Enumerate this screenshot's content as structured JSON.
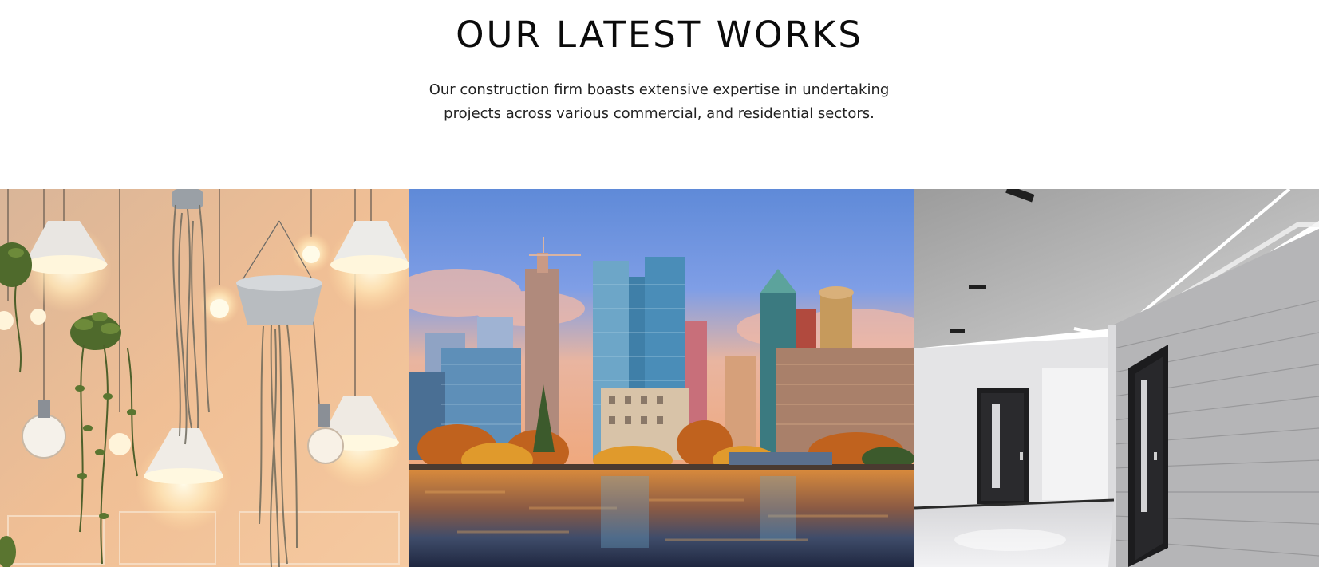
{
  "section": {
    "title": "OUR LATEST WORKS",
    "description": "Our construction firm boasts extensive expertise in undertaking projects across various commercial, and residential sectors."
  },
  "works": [
    {
      "image": "pendant-lamps-hanging-plants-photo"
    },
    {
      "image": "city-skyline-waterfront-photo"
    },
    {
      "image": "modern-interior-hallway-doors-photo"
    }
  ]
}
